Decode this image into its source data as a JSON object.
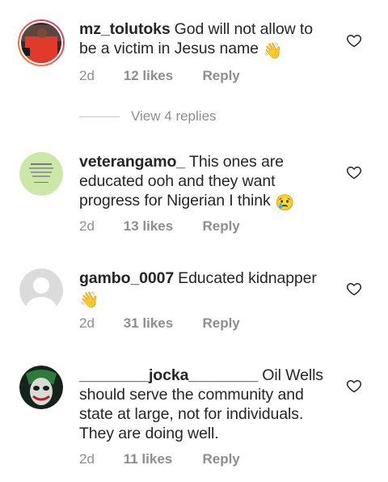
{
  "comments": [
    {
      "username": "mz_tolutoks",
      "text": "God will not allow to be a victim in Jesus name",
      "emoji": "👋",
      "time": "2d",
      "likes": "12 likes",
      "reply": "Reply"
    },
    {
      "username": "veterangamo_",
      "text": "This ones are educated ooh and they want progress for Nigerian I think",
      "emoji": "😢",
      "time": "2d",
      "likes": "13 likes",
      "reply": "Reply"
    },
    {
      "username": "gambo_0007",
      "text": "Educated kidnapper",
      "emoji": "👋",
      "time": "2d",
      "likes": "31 likes",
      "reply": "Reply"
    },
    {
      "username": "________jocka________",
      "text": "Oil Wells should serve the community and state at large, not for individuals. They are doing well.",
      "emoji": "",
      "time": "2d",
      "likes": "11 likes",
      "reply": "Reply"
    }
  ],
  "view_replies": "View 4 replies",
  "colors": {
    "story_ring_start": "#f58529",
    "story_ring_end": "#dd2a7b",
    "secondary_text": "#8e8e8e"
  },
  "icons": {
    "like": "heart-outline-icon"
  }
}
